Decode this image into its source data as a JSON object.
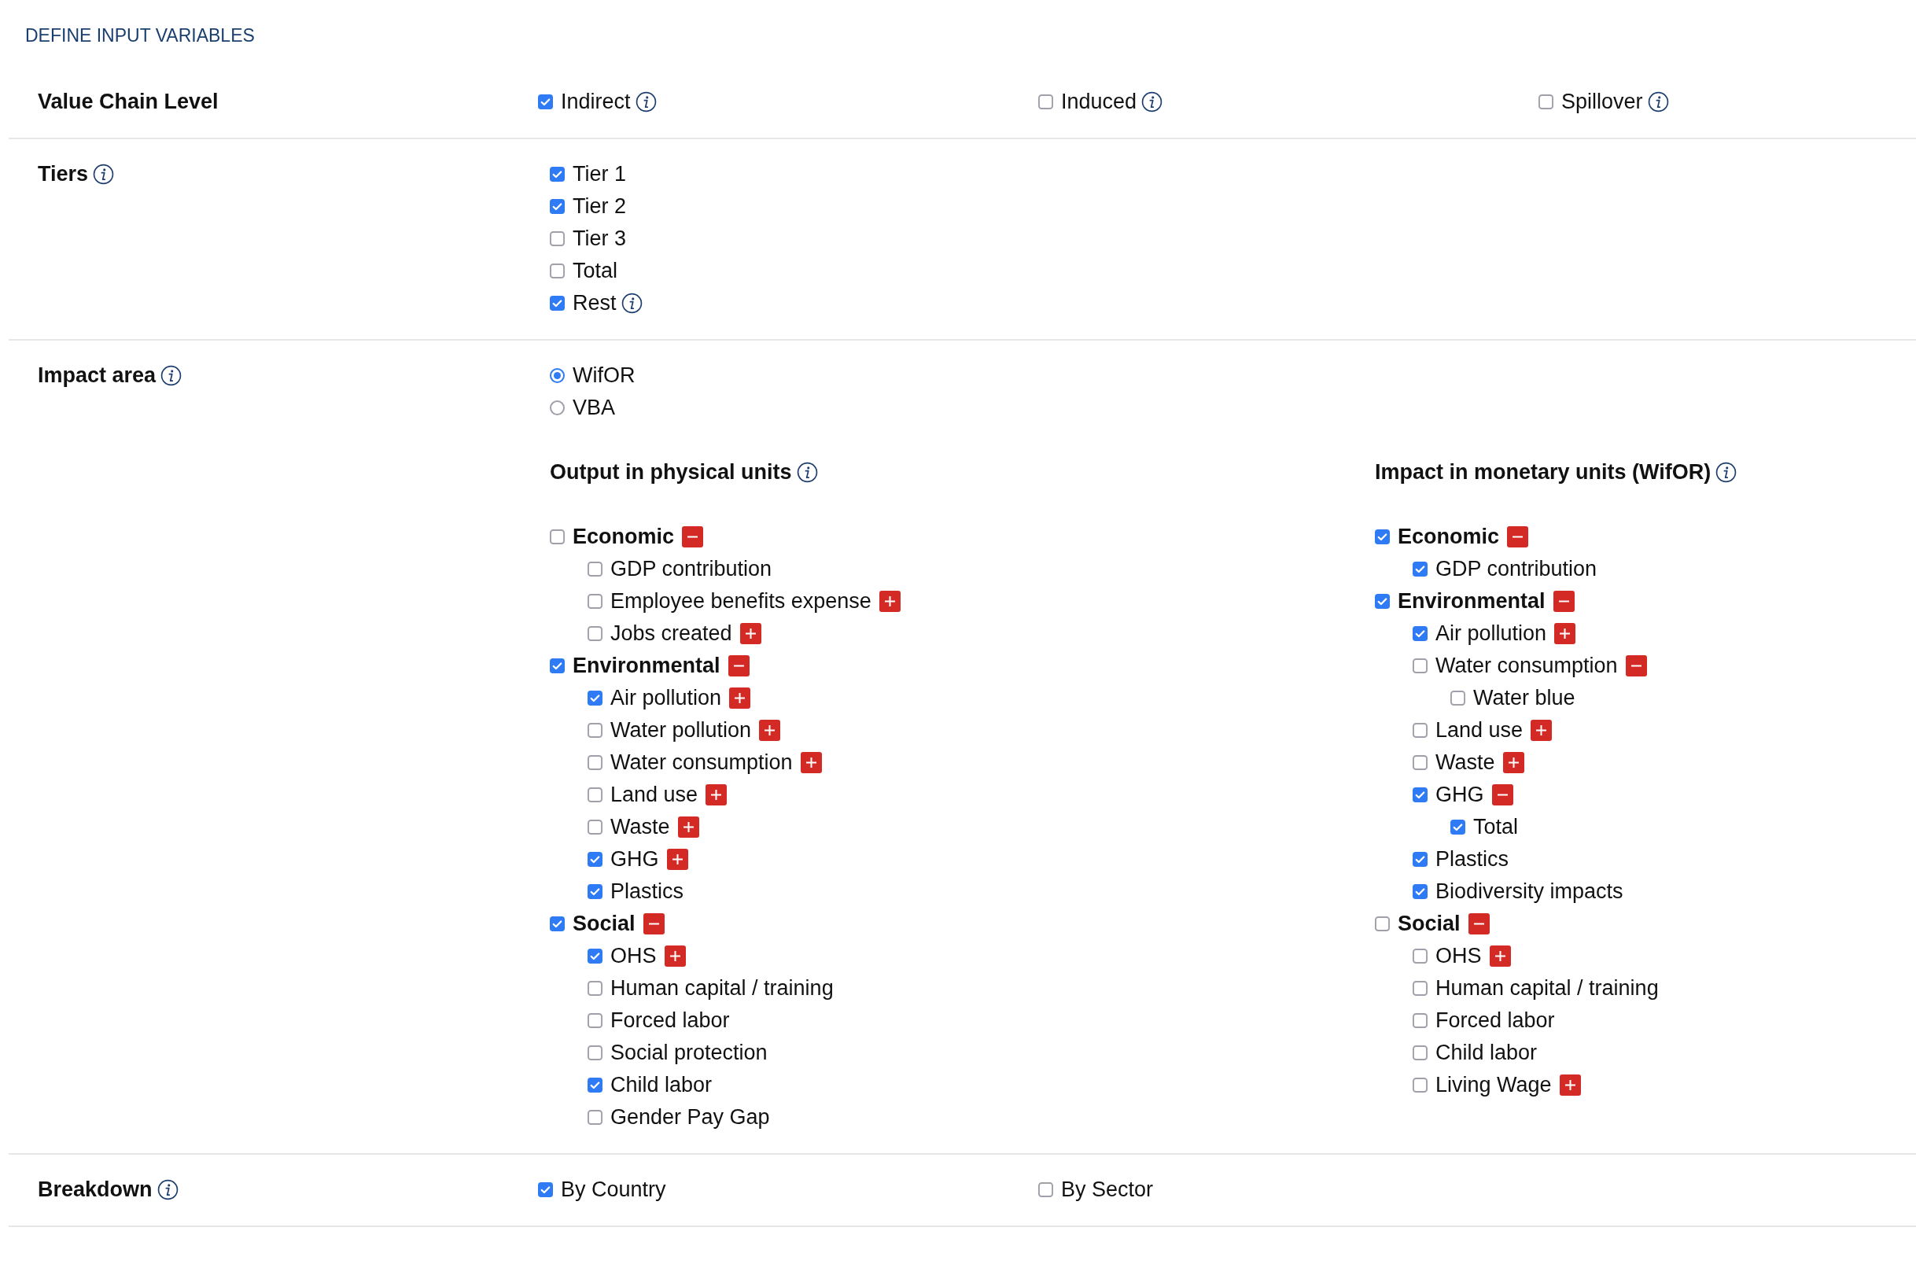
{
  "heading": "DEFINE INPUT VARIABLES",
  "sections": [
    {
      "kind": "columns",
      "label": "Value Chain Level",
      "options": [
        {
          "label": "Indirect",
          "checked": true,
          "info": true
        },
        {
          "label": "Induced",
          "checked": false,
          "info": true
        },
        {
          "label": "Spillover",
          "checked": false,
          "info": true
        }
      ]
    },
    {
      "kind": "list",
      "label": "Tiers",
      "info": true,
      "options": [
        {
          "label": "Tier 1",
          "checked": true
        },
        {
          "label": "Tier 2",
          "checked": true
        },
        {
          "label": "Tier 3",
          "checked": false
        },
        {
          "label": "Total",
          "checked": false
        },
        {
          "label": "Rest",
          "checked": true,
          "info": true
        }
      ]
    },
    {
      "kind": "impact",
      "label": "Impact area",
      "info": true,
      "radios": [
        {
          "label": "WifOR",
          "selected": true
        },
        {
          "label": "VBA",
          "selected": false
        }
      ],
      "trees": [
        {
          "title": "Output in physical units",
          "info": true,
          "nodes": [
            {
              "label": "Economic",
              "checked": false,
              "expanded": true,
              "children": [
                {
                  "label": "GDP contribution",
                  "checked": false
                },
                {
                  "label": "Employee benefits expense",
                  "checked": false,
                  "expanded": false
                },
                {
                  "label": "Jobs created",
                  "checked": false,
                  "expanded": false
                }
              ]
            },
            {
              "label": "Environmental",
              "checked": true,
              "expanded": true,
              "children": [
                {
                  "label": "Air pollution",
                  "checked": true,
                  "expanded": false
                },
                {
                  "label": "Water pollution",
                  "checked": false,
                  "expanded": false
                },
                {
                  "label": "Water consumption",
                  "checked": false,
                  "expanded": false
                },
                {
                  "label": "Land use",
                  "checked": false,
                  "expanded": false
                },
                {
                  "label": "Waste",
                  "checked": false,
                  "expanded": false
                },
                {
                  "label": "GHG",
                  "checked": true,
                  "expanded": false
                },
                {
                  "label": "Plastics",
                  "checked": true
                }
              ]
            },
            {
              "label": "Social",
              "checked": true,
              "expanded": true,
              "children": [
                {
                  "label": "OHS",
                  "checked": true,
                  "expanded": false
                },
                {
                  "label": "Human capital / training",
                  "checked": false
                },
                {
                  "label": "Forced labor",
                  "checked": false
                },
                {
                  "label": "Social protection",
                  "checked": false
                },
                {
                  "label": "Child labor",
                  "checked": true
                },
                {
                  "label": "Gender Pay Gap",
                  "checked": false
                }
              ]
            }
          ]
        },
        {
          "title": "Impact in monetary units (WifOR)",
          "info": true,
          "nodes": [
            {
              "label": "Economic",
              "checked": true,
              "expanded": true,
              "children": [
                {
                  "label": "GDP contribution",
                  "checked": true
                }
              ]
            },
            {
              "label": "Environmental",
              "checked": true,
              "expanded": true,
              "children": [
                {
                  "label": "Air pollution",
                  "checked": true,
                  "expanded": false
                },
                {
                  "label": "Water consumption",
                  "checked": false,
                  "expanded": true,
                  "children": [
                    {
                      "label": "Water blue",
                      "checked": false
                    }
                  ]
                },
                {
                  "label": "Land use",
                  "checked": false,
                  "expanded": false
                },
                {
                  "label": "Waste",
                  "checked": false,
                  "expanded": false
                },
                {
                  "label": "GHG",
                  "checked": true,
                  "expanded": true,
                  "children": [
                    {
                      "label": "Total",
                      "checked": true
                    }
                  ]
                },
                {
                  "label": "Plastics",
                  "checked": true
                },
                {
                  "label": "Biodiversity impacts",
                  "checked": true
                }
              ]
            },
            {
              "label": "Social",
              "checked": false,
              "expanded": true,
              "children": [
                {
                  "label": "OHS",
                  "checked": false,
                  "expanded": false
                },
                {
                  "label": "Human capital / training",
                  "checked": false
                },
                {
                  "label": "Forced labor",
                  "checked": false
                },
                {
                  "label": "Child labor",
                  "checked": false
                },
                {
                  "label": "Living Wage",
                  "checked": false,
                  "expanded": false
                }
              ]
            }
          ]
        }
      ]
    },
    {
      "kind": "columns",
      "label": "Breakdown",
      "info": true,
      "options": [
        {
          "label": "By Country",
          "checked": true
        },
        {
          "label": "By Sector",
          "checked": false
        }
      ]
    }
  ]
}
